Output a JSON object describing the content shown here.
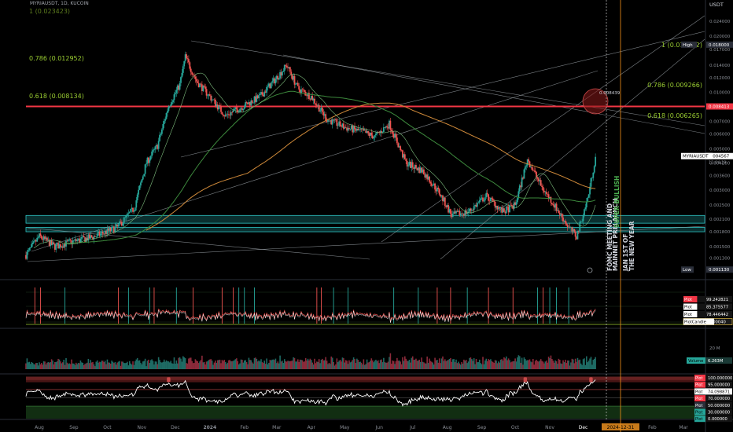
{
  "header": {
    "symbol": "MYRIAUSDT, 1D, KUCOIN",
    "currency": "USDT"
  },
  "colors": {
    "background": "#000000",
    "up": "#26a69a",
    "down": "#ef5350",
    "red_line": "#f23645",
    "orange": "#f7931a",
    "green_ma": "#3d8a3d",
    "orange_ma": "#d08a3a",
    "teal_zone": "#1e8a8a",
    "fib_text": "#9acd32",
    "grid": "#0c0c0c"
  },
  "chart_data": [
    {
      "type": "candlestick",
      "title": "MYRIAUSDT, 1D, KUCOIN",
      "y_scale": "log",
      "y_ticks": [
        "0.024000",
        "0.020000",
        "0.017000",
        "0.014000",
        "0.012000",
        "0.010000",
        "0.008500",
        "0.007000",
        "0.006000",
        "0.005000",
        "0.004200",
        "0.003600",
        "0.003000",
        "0.002500",
        "0.002100",
        "0.001800",
        "0.001500",
        "0.001300",
        "0.001100"
      ],
      "x_ticks": [
        "Aug",
        "Sep",
        "Oct",
        "Nov",
        "Dec",
        "2024",
        "Feb",
        "Mar",
        "Apr",
        "May",
        "Jun",
        "Jul",
        "Aug",
        "Sep",
        "Oct",
        "Nov",
        "Dec",
        "Feb",
        "Mar"
      ],
      "highlighted_x_tick": "Dec",
      "cursor_date_label": "2024-12-31",
      "series": [
        {
          "name": "price_anchors_date_close",
          "points": [
            [
              "2023-07-20",
              0.00135
            ],
            [
              "2023-08-01",
              0.0017
            ],
            [
              "2023-08-15",
              0.0015
            ],
            [
              "2023-09-01",
              0.0016
            ],
            [
              "2023-09-20",
              0.0017
            ],
            [
              "2023-10-10",
              0.0019
            ],
            [
              "2023-10-25",
              0.0024
            ],
            [
              "2023-11-05",
              0.0042
            ],
            [
              "2023-11-15",
              0.0052
            ],
            [
              "2023-11-25",
              0.0085
            ],
            [
              "2023-12-05",
              0.011
            ],
            [
              "2023-12-10",
              0.0155
            ],
            [
              "2023-12-20",
              0.0115
            ],
            [
              "2024-01-01",
              0.0095
            ],
            [
              "2024-01-15",
              0.0075
            ],
            [
              "2024-02-01",
              0.0085
            ],
            [
              "2024-02-15",
              0.0095
            ],
            [
              "2024-03-01",
              0.012
            ],
            [
              "2024-03-10",
              0.014
            ],
            [
              "2024-03-20",
              0.0105
            ],
            [
              "2024-04-01",
              0.0095
            ],
            [
              "2024-04-15",
              0.0072
            ],
            [
              "2024-05-01",
              0.0065
            ],
            [
              "2024-05-15",
              0.0062
            ],
            [
              "2024-05-28",
              0.0058
            ],
            [
              "2024-06-10",
              0.0068
            ],
            [
              "2024-06-25",
              0.0042
            ],
            [
              "2024-07-10",
              0.0038
            ],
            [
              "2024-07-25",
              0.0029
            ],
            [
              "2024-08-05",
              0.0022
            ],
            [
              "2024-08-20",
              0.0023
            ],
            [
              "2024-09-05",
              0.0028
            ],
            [
              "2024-09-20",
              0.0023
            ],
            [
              "2024-10-01",
              0.0025
            ],
            [
              "2024-10-12",
              0.0044
            ],
            [
              "2024-10-25",
              0.0031
            ],
            [
              "2024-11-05",
              0.0025
            ],
            [
              "2024-11-18",
              0.0019
            ],
            [
              "2024-11-25",
              0.0017
            ],
            [
              "2024-12-05",
              0.0027
            ],
            [
              "2024-12-12",
              0.0045
            ]
          ]
        }
      ],
      "price_labels": [
        {
          "label": "High",
          "value": "0.018000"
        },
        {
          "label": "",
          "value": "0.008413"
        },
        {
          "label": "MYRIAUSDT",
          "value": "0.004567",
          "countdown": "12:04:19"
        },
        {
          "label": "Low",
          "value": "0.001130"
        }
      ],
      "fib_levels": [
        {
          "text": "1 (0.023423)",
          "price": 0.023423
        },
        {
          "text": "0.786 (0.012952)",
          "price": 0.012952
        },
        {
          "text": "0.618 (0.008134)",
          "price": 0.008134
        },
        {
          "text": "1 (0.015252)",
          "price": 0.015252
        },
        {
          "text": "0.786 (0.009266)",
          "price": 0.009266
        },
        {
          "text": "0.618 (0.006265)",
          "price": 0.006265
        }
      ],
      "circle_label": "0.008439",
      "horizontal_line_price": 0.008413,
      "support_zones": [
        [
          0.002,
          0.0022
        ],
        [
          0.0018,
          0.0019
        ]
      ],
      "annotations": [
        "FOMC MEETING AND",
        "MAINNET PRELAUNCH",
        "SUPER BULLISH",
        "JAN 1ST OF",
        "THE NEW YEAR"
      ]
    },
    {
      "type": "line",
      "title": "",
      "legend": [
        {
          "label": "Plot",
          "value": "99.242821"
        },
        {
          "label": "Plot",
          "value": "85.375577"
        },
        {
          "label": "Plot",
          "value": "78.446442"
        },
        {
          "label": "PlotCandle",
          "value": "0.000040"
        }
      ]
    },
    {
      "type": "bar",
      "title": "",
      "y_ticks": [
        "20 M"
      ],
      "legend": [
        {
          "label": "Volume",
          "value": "6.263M"
        }
      ]
    },
    {
      "type": "line",
      "title": "",
      "levels": [
        "100.000000",
        "95.000000",
        "74.098871",
        "70.000000",
        "50.000000",
        "30.000000",
        "0.000000"
      ],
      "level_labels": [
        "Plot",
        "Plot",
        "Plot",
        "Plot",
        "Plot",
        "Plot",
        "Plot"
      ]
    }
  ]
}
